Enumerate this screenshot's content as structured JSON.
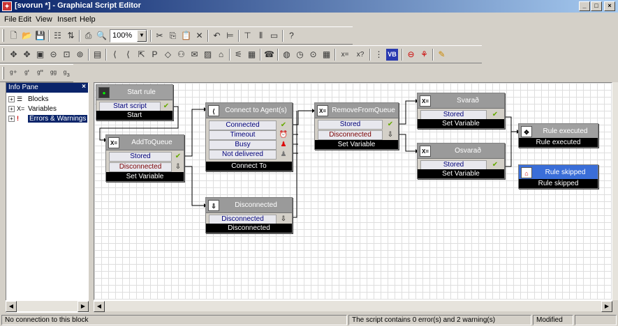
{
  "window": {
    "title": "[svorun *] - Graphical Script Editor",
    "app_icon": "app-icon"
  },
  "menu": [
    "File",
    "Edit",
    "View",
    "Insert",
    "Help"
  ],
  "toolbar": {
    "zoom_value": "100%"
  },
  "info_pane": {
    "title": "Info Pane",
    "close_glyph": "×",
    "tree": [
      {
        "label": "Blocks",
        "icon": "blocks-icon"
      },
      {
        "label": "Variables",
        "icon": "variables-icon"
      },
      {
        "label": "Errors & Warnings",
        "icon": "errors-icon"
      }
    ]
  },
  "blocks": {
    "start_rule": {
      "title": "Start rule",
      "rows": [
        "Start script"
      ],
      "footer": "Start"
    },
    "add_to_queue": {
      "title": "AddToQueue",
      "rows": [
        "Stored",
        "Disconnected"
      ],
      "footer": "Set Variable"
    },
    "connect_to_agent": {
      "title": "Connect to Agent(s)",
      "rows": [
        "Connected",
        "Timeout",
        "Busy",
        "Not delivered"
      ],
      "footer": "Connect To"
    },
    "disconnected": {
      "title": "Disconnected",
      "rows": [
        "Disconnected"
      ],
      "footer": "Disconnected"
    },
    "remove_from_queue": {
      "title": "RemoveFromQueue",
      "rows": [
        "Stored",
        "Disconnected"
      ],
      "footer": "Set Variable"
    },
    "svarad": {
      "title": "Svarað",
      "rows": [
        "Stored"
      ],
      "footer": "Set Variable"
    },
    "osvarad": {
      "title": "Ósvarað",
      "rows": [
        "Stored"
      ],
      "footer": "Set Variable"
    },
    "rule_executed": {
      "title": "Rule executed",
      "footer": "Rule executed"
    },
    "rule_skipped": {
      "title": "Rule skipped",
      "footer": "Rule skipped"
    }
  },
  "status": {
    "left": "No connection to this block",
    "middle": "The script contains 0 error(s) and 2 warning(s)",
    "right": "Modified"
  },
  "colors": {
    "title_bar_start": "#0a246a",
    "title_bar_end": "#a6caf0",
    "block_footer": "#000000",
    "selected_block_header": "#3a6ed8"
  }
}
